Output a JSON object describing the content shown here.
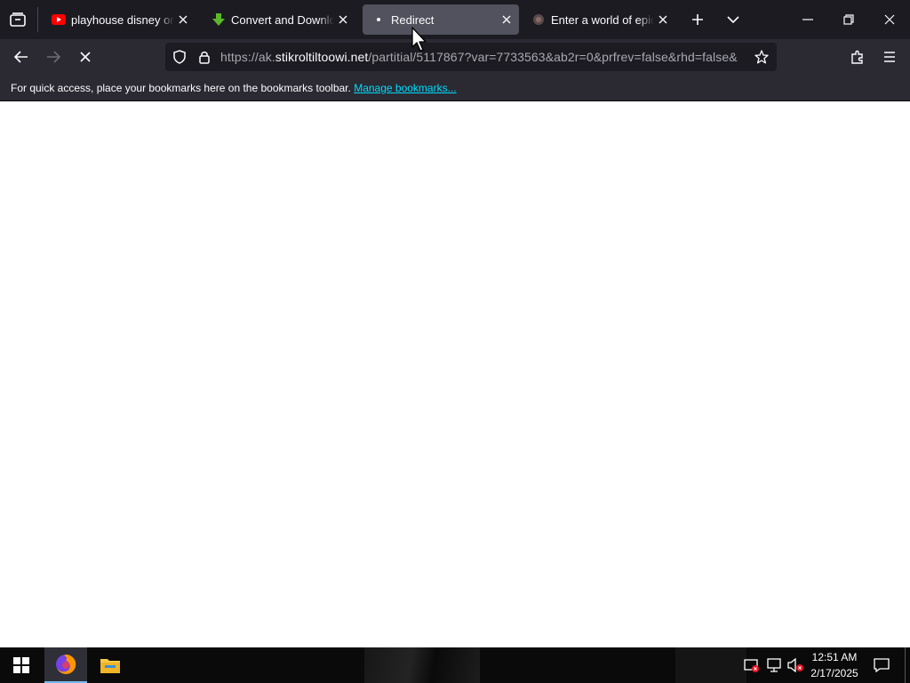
{
  "tabs": [
    {
      "title": "playhouse disney origi",
      "favicon": "youtube-icon"
    },
    {
      "title": "Convert and Download",
      "favicon": "download-arrow-icon"
    },
    {
      "title": "Redirect",
      "favicon": "dot-icon",
      "active": true
    },
    {
      "title": "Enter a world of epic b",
      "favicon": "site-icon"
    }
  ],
  "address_bar": {
    "prefix": "https://ak.",
    "domain": "stikroltiltoowi.net",
    "path": "/partitial/5117867?var=7733563&ab2r=0&prfrev=false&rhd=false&"
  },
  "bookmarks_bar": {
    "message": "For quick access, place your bookmarks here on the bookmarks toolbar.",
    "link": "Manage bookmarks..."
  },
  "taskbar": {
    "time": "12:51 AM",
    "date": "2/17/2025"
  },
  "colors": {
    "tabbar_bg": "#1c1b22",
    "toolbar_bg": "#2b2a33",
    "active_tab": "#52525e",
    "link": "#00ddff",
    "youtube_red": "#ff0000",
    "download_green": "#5cb82a"
  }
}
